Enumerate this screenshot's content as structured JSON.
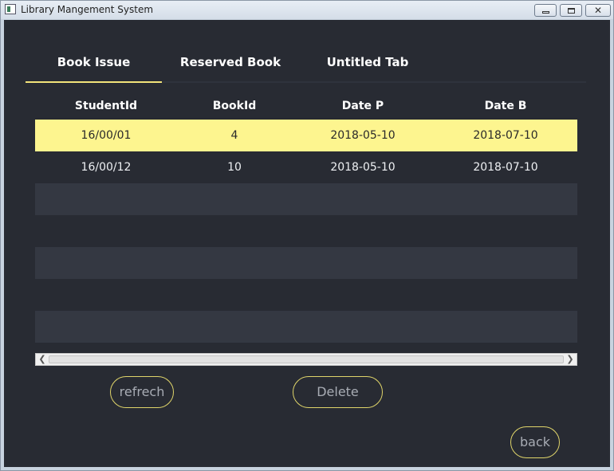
{
  "window": {
    "title": "Library Mangement System",
    "controls": {
      "minimize": "",
      "maximize": "",
      "close": "✕"
    }
  },
  "tabs": [
    {
      "label": "Book Issue",
      "active": true
    },
    {
      "label": "Reserved Book",
      "active": false
    },
    {
      "label": "Untitled Tab",
      "active": false
    }
  ],
  "table": {
    "columns": [
      "StudentId",
      "BookId",
      "Date P",
      "Date B"
    ],
    "rows": [
      [
        "16/00/01",
        "4",
        "2018-05-10",
        "2018-07-10"
      ],
      [
        "16/00/12",
        "10",
        "2018-05-10",
        "2018-07-10"
      ]
    ],
    "selected_row": 0
  },
  "scrollbar": {
    "left_arrow": "❮",
    "right_arrow": "❯"
  },
  "buttons": {
    "refresh": "refrech",
    "delete": "Delete",
    "back": "back"
  },
  "colors": {
    "background": "#282b33",
    "accent": "#f3e37a",
    "selected_row": "#fdf58f"
  }
}
